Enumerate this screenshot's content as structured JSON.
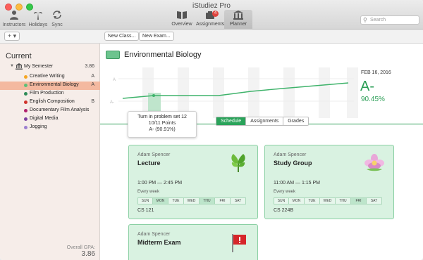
{
  "app": {
    "title": "iStudiez Pro"
  },
  "toolbar": {
    "instructors": "Instructors",
    "holidays": "Holidays",
    "sync": "Sync",
    "overview": "Overview",
    "assignments": "Assignments",
    "assignments_badge": "4",
    "planner": "Planner",
    "search_placeholder": "Search"
  },
  "subbar": {
    "add_label": "+ ▾",
    "new_class": "New Class...",
    "new_exam": "New Exam..."
  },
  "sidebar": {
    "heading": "Current",
    "semester": {
      "name": "My Semester",
      "gpa": "3.86"
    },
    "courses": [
      {
        "name": "Creative Writing",
        "grade": "A",
        "color": "#f5a623"
      },
      {
        "name": "Environmental Biology",
        "grade": "A",
        "color": "#5cbf78"
      },
      {
        "name": "Film Production",
        "grade": "",
        "color": "#2e8b57"
      },
      {
        "name": "English Composition",
        "grade": "B",
        "color": "#d0342c"
      },
      {
        "name": "Documentary Film Analysis",
        "grade": "",
        "color": "#b01f6c"
      },
      {
        "name": "Digital Media",
        "grade": "",
        "color": "#7b3fa0"
      },
      {
        "name": "Jogging",
        "grade": "",
        "color": "#9b7fd0"
      }
    ],
    "overall_gpa_label": "Overall GPA:",
    "overall_gpa": "3.86"
  },
  "main": {
    "course_title": "Environmental Biology",
    "course_color": "#6cc48e",
    "grade": {
      "date": "FEB 16, 2016",
      "letter": "A-",
      "percent": "90.45%"
    },
    "chart_axis": {
      "top": "A",
      "bottom": "A-"
    },
    "tooltip": {
      "title": "Turn in problem set 12",
      "points": "10/11 Points",
      "grade": "A- (90.91%)"
    },
    "tabs": [
      "Schedule",
      "Assignments",
      "Grades"
    ],
    "cards": [
      {
        "instructor": "Adam Spencer",
        "kind": "Lecture",
        "time": "1:00 PM — 2:45 PM",
        "frequency": "Every week",
        "room": "CS 121",
        "icon": "leaf-icon",
        "days": [
          "SUN",
          "MON",
          "TUE",
          "WED",
          "THU",
          "FRI",
          "SAT"
        ],
        "active_days": [
          1,
          4
        ]
      },
      {
        "instructor": "Adam Spencer",
        "kind": "Study Group",
        "time": "11:00 AM — 1:15 PM",
        "frequency": "Every week",
        "room": "CS 224B",
        "icon": "flower-icon",
        "days": [
          "SUN",
          "MON",
          "TUE",
          "WED",
          "THU",
          "FRI",
          "SAT"
        ],
        "active_days": [
          5
        ]
      },
      {
        "instructor": "Adam Spencer",
        "kind": "Midterm Exam",
        "icon": "flag-icon"
      }
    ]
  }
}
